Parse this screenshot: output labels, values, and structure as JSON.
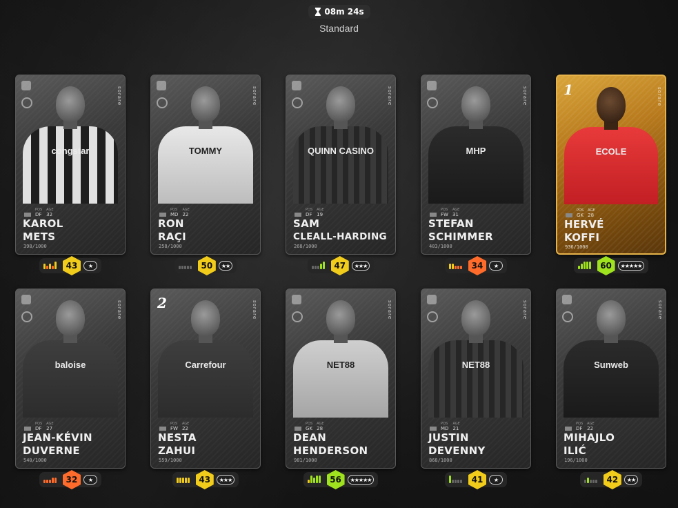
{
  "header": {
    "timer": "08m 24s",
    "mode": "Standard"
  },
  "brand_text": "sorare",
  "meta_labels": {
    "pos": "POS",
    "age": "AGE"
  },
  "colors": {
    "yellow": "#f2cc1b",
    "orange": "#ff6b2b",
    "green": "#9fe31e",
    "gold_card": "#d9a53a"
  },
  "cards": [
    {
      "name_first": "KAROL",
      "name_last": "METS",
      "position": "DF",
      "age": "32",
      "serial": "398/1000",
      "score": "43",
      "score_tier": "yellow",
      "stars": "★",
      "form": [
        2,
        1,
        2,
        1,
        3
      ],
      "form_colors": [
        "yellow",
        "orange",
        "yellow",
        "orange",
        "yellow"
      ],
      "rarity": "limited",
      "shirt": "stripes",
      "sponsor": "congstar",
      "sponsor_style": "ondark",
      "tag": ""
    },
    {
      "name_first": "RON",
      "name_last": "RAÇI",
      "position": "MD",
      "age": "22",
      "serial": "258/1000",
      "score": "50",
      "score_tier": "yellow",
      "stars": "★★",
      "form": [
        1,
        1,
        1,
        1,
        1
      ],
      "form_colors": [
        "grey",
        "grey",
        "grey",
        "grey",
        "grey"
      ],
      "rarity": "limited",
      "shirt": "white",
      "sponsor": "TOMMY",
      "sponsor_style": "onlight",
      "tag": ""
    },
    {
      "name_first": "SAM",
      "name_last": "CLEALL-HARDING",
      "position": "DF",
      "age": "19",
      "serial": "268/1000",
      "score": "47",
      "score_tier": "yellow",
      "stars": "★★★",
      "form": [
        1,
        1,
        1,
        2,
        3
      ],
      "form_colors": [
        "grey",
        "grey",
        "grey",
        "green",
        "green"
      ],
      "rarity": "limited",
      "shirt": "vstripes",
      "sponsor": "QUINN CASINO",
      "sponsor_style": "ondark",
      "tag": ""
    },
    {
      "name_first": "STEFAN",
      "name_last": "SCHIMMER",
      "position": "FW",
      "age": "31",
      "serial": "403/1000",
      "score": "34",
      "score_tier": "orange",
      "stars": "★",
      "form": [
        2,
        2,
        1,
        1,
        1
      ],
      "form_colors": [
        "yellow",
        "yellow",
        "orange",
        "orange",
        "orange"
      ],
      "rarity": "limited",
      "shirt": "dark",
      "sponsor": "MHP",
      "sponsor_style": "ondark",
      "tag": ""
    },
    {
      "name_first": "HERVÉ",
      "name_last": "KOFFI",
      "position": "GK",
      "age": "28",
      "serial": "936/1000",
      "score": "60",
      "score_tier": "green",
      "stars": "★★★★★",
      "form": [
        1,
        2,
        3,
        3,
        3
      ],
      "form_colors": [
        "green",
        "green",
        "green",
        "green",
        "green"
      ],
      "rarity": "gold",
      "shirt": "red",
      "sponsor": "ECOLE",
      "sponsor_style": "ondark",
      "tag": "1"
    },
    {
      "name_first": "JEAN-KÉVIN",
      "name_last": "DUVERNE",
      "position": "DF",
      "age": "27",
      "serial": "540/1000",
      "score": "32",
      "score_tier": "orange",
      "stars": "★",
      "form": [
        1,
        1,
        1,
        2,
        2
      ],
      "form_colors": [
        "orange",
        "orange",
        "orange",
        "orange",
        "orange"
      ],
      "rarity": "limited",
      "shirt": "mid",
      "sponsor": "baloise",
      "sponsor_style": "ondark",
      "tag": ""
    },
    {
      "name_first": "NESTA",
      "name_last": "ZAHUI",
      "position": "FW",
      "age": "22",
      "serial": "559/1000",
      "score": "43",
      "score_tier": "yellow",
      "stars": "★★★",
      "form": [
        2,
        2,
        2,
        2,
        2
      ],
      "form_colors": [
        "yellow",
        "yellow",
        "yellow",
        "yellow",
        "yellow"
      ],
      "rarity": "limited",
      "shirt": "mid",
      "sponsor": "Carrefour",
      "sponsor_style": "ondark",
      "tag": "2"
    },
    {
      "name_first": "DEAN",
      "name_last": "HENDERSON",
      "position": "GK",
      "age": "28",
      "serial": "981/1000",
      "score": "56",
      "score_tier": "green",
      "stars": "★★★★★",
      "form": [
        1,
        3,
        2,
        3,
        3
      ],
      "form_colors": [
        "yellow",
        "green",
        "green",
        "green",
        "green"
      ],
      "rarity": "limited",
      "shirt": "light",
      "sponsor": "NET88",
      "sponsor_style": "onlight",
      "tag": ""
    },
    {
      "name_first": "JUSTIN",
      "name_last": "DEVENNY",
      "position": "MD",
      "age": "21",
      "serial": "868/1000",
      "score": "41",
      "score_tier": "yellow",
      "stars": "★",
      "form": [
        3,
        1,
        1,
        1,
        1
      ],
      "form_colors": [
        "green",
        "grey",
        "grey",
        "grey",
        "grey"
      ],
      "rarity": "limited",
      "shirt": "vstripes",
      "sponsor": "NET88",
      "sponsor_style": "ondark",
      "tag": ""
    },
    {
      "name_first": "MIHAJLO",
      "name_last": "ILIĆ",
      "position": "DF",
      "age": "22",
      "serial": "196/1000",
      "score": "42",
      "score_tier": "yellow",
      "stars": "★★",
      "form": [
        1,
        2,
        1,
        1,
        1
      ],
      "form_colors": [
        "grey",
        "green",
        "grey",
        "grey",
        "grey"
      ],
      "rarity": "limited",
      "shirt": "dark",
      "sponsor": "Sunweb",
      "sponsor_style": "ondark",
      "tag": ""
    }
  ]
}
